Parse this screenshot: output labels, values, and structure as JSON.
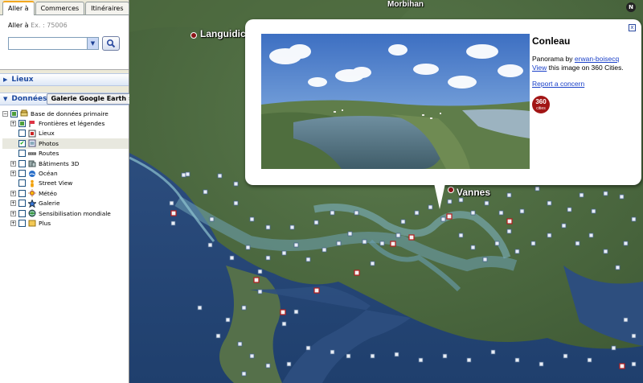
{
  "tabs": [
    "Aller à",
    "Commerces",
    "Itinéraires"
  ],
  "goto": {
    "label": "Aller à",
    "placeholder": "Ex. : 75006",
    "input_value": ""
  },
  "sections": {
    "lieux": "Lieux",
    "donnees": "Données",
    "gallery_button": "Galerie Google Earth"
  },
  "layers": [
    {
      "label": "Base de données primaire",
      "level": 0,
      "expander": "−",
      "checked": "partial",
      "icon": "globe-layers-icon",
      "selected": false
    },
    {
      "label": "Frontières et légendes",
      "level": 1,
      "expander": "+",
      "checked": "partial",
      "icon": "border-flag-icon",
      "selected": false
    },
    {
      "label": "Lieux",
      "level": 1,
      "expander": "",
      "checked": "none",
      "icon": "place-marker-icon",
      "selected": false
    },
    {
      "label": "Photos",
      "level": 1,
      "expander": "",
      "checked": "checked",
      "icon": "photo-icon",
      "selected": true
    },
    {
      "label": "Routes",
      "level": 1,
      "expander": "",
      "checked": "none",
      "icon": "road-icon",
      "selected": false
    },
    {
      "label": "Bâtiments 3D",
      "level": 1,
      "expander": "+",
      "checked": "none",
      "icon": "building-3d-icon",
      "selected": false
    },
    {
      "label": "Océan",
      "level": 1,
      "expander": "+",
      "checked": "none",
      "icon": "ocean-icon",
      "selected": false
    },
    {
      "label": "Street View",
      "level": 1,
      "expander": "",
      "checked": "none",
      "icon": "street-view-person-icon",
      "selected": false
    },
    {
      "label": "Météo",
      "level": 1,
      "expander": "+",
      "checked": "none",
      "icon": "weather-sun-icon",
      "selected": false
    },
    {
      "label": "Galerie",
      "level": 1,
      "expander": "+",
      "checked": "none",
      "icon": "gallery-star-icon",
      "selected": false
    },
    {
      "label": "Sensibilisation mondiale",
      "level": 1,
      "expander": "+",
      "checked": "none",
      "icon": "global-awareness-icon",
      "selected": false
    },
    {
      "label": "Plus",
      "level": 1,
      "expander": "+",
      "checked": "none",
      "icon": "more-folder-icon",
      "selected": false
    }
  ],
  "map_labels": [
    {
      "name": "Languidic",
      "has_dot": true
    },
    {
      "name": "Morbihan",
      "has_dot": false
    },
    {
      "name": "Vannes",
      "has_dot": true
    }
  ],
  "compass_letter": "N",
  "popup": {
    "title": "Conleau",
    "line1_prefix": "Panorama by ",
    "author": "erwan-boisecq",
    "view_link": "View",
    "line2_suffix": " this image on 360 Cities.",
    "report_link": "Report a concern",
    "logo_top": "360",
    "logo_bottom": "cities",
    "close_glyph": "x"
  },
  "colors": {
    "accent_tab": "#f3a71e",
    "link": "#1a40c8",
    "photo_marker": "#c9302c",
    "section_text": "#1e4aa0"
  }
}
